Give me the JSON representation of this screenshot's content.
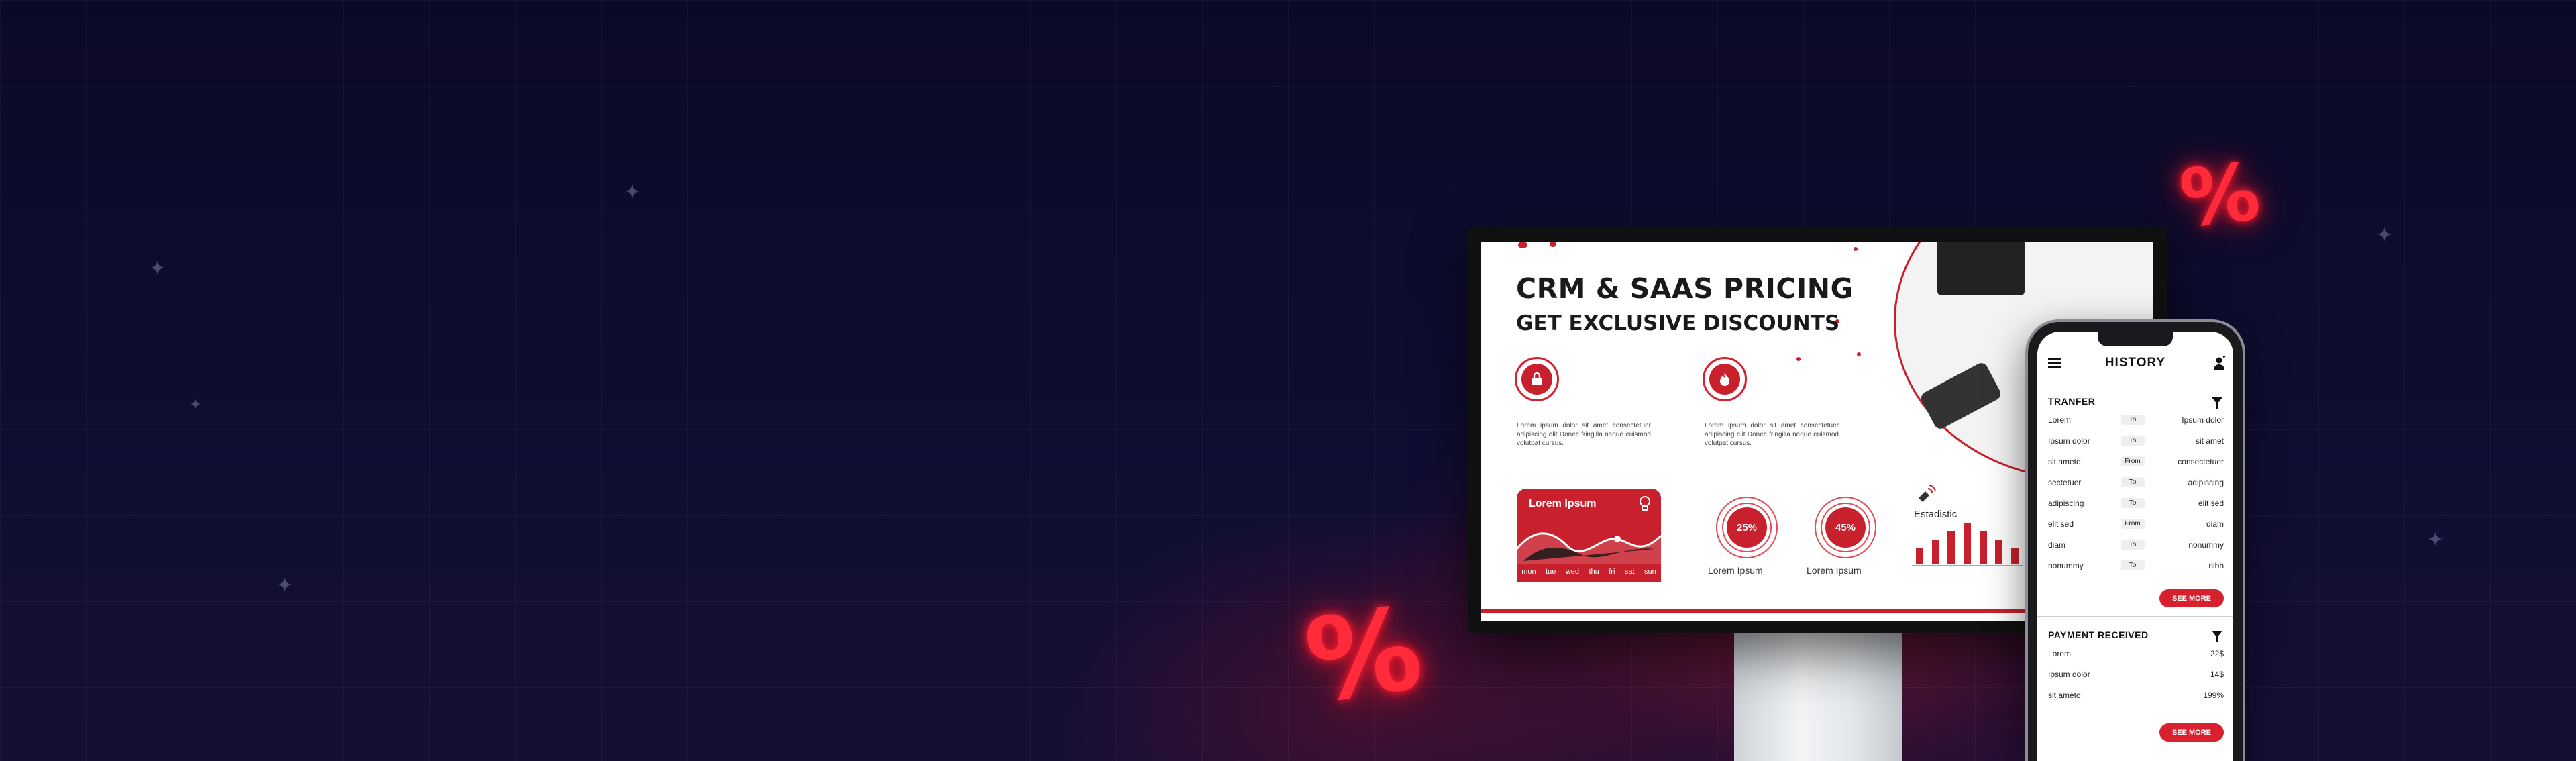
{
  "colors": {
    "accent": "#c8202c",
    "background": "#0c0b2a",
    "neon": "#ff2a3a"
  },
  "decor": {
    "percent_symbol": "%"
  },
  "monitor": {
    "title": "CRM & SAAS PRICING",
    "subtitle": "GET EXCLUSIVE DISCOUNTS",
    "feature_icons": [
      "lock-icon",
      "flame-icon"
    ],
    "lorem_block": "Lorem ipsum dolor sit amet consectetuer adipiscing elit Donec fringilla neque euismod volutpat cursus.",
    "wave_card": {
      "title": "Lorem Ipsum",
      "icon": "lightbulb-icon",
      "days": [
        "mon",
        "tue",
        "wed",
        "thu",
        "fri",
        "sat",
        "sun"
      ]
    },
    "percent_rings": [
      {
        "value": "25%",
        "label": "Lorem Ipsum"
      },
      {
        "value": "45%",
        "label": "Lorem Ipsum"
      }
    ],
    "statistic": {
      "label": "Estadistic",
      "icon": "satellite-icon"
    }
  },
  "chart_data": {
    "type": "bar",
    "values": [
      2,
      3,
      4,
      5,
      4,
      3,
      2
    ],
    "categories": [],
    "title": "Estadistic",
    "xlabel": "",
    "ylabel": ""
  },
  "phone": {
    "title": "HISTORY",
    "transfer": {
      "title": "TRANFER",
      "rows": [
        {
          "left": "Lorem",
          "mid": "To",
          "right": "Ipsum dolor"
        },
        {
          "left": "Ipsum dolor",
          "mid": "To",
          "right": "sit amet"
        },
        {
          "left": "sit ameto",
          "mid": "From",
          "right": "consectetuer"
        },
        {
          "left": "sectetuer",
          "mid": "To",
          "right": "adipiscing"
        },
        {
          "left": "adipiscing",
          "mid": "To",
          "right": "elit sed"
        },
        {
          "left": "elit sed",
          "mid": "From",
          "right": "diam"
        },
        {
          "left": "diam",
          "mid": "To",
          "right": "nonummy"
        },
        {
          "left": "nonummy",
          "mid": "To",
          "right": "nibh"
        }
      ],
      "see_more": "SEE MORE"
    },
    "payment": {
      "title": "PAYMENT RECEIVED",
      "rows": [
        {
          "left": "Lorem",
          "right": "22$"
        },
        {
          "left": "Ipsum dolor",
          "right": "14$"
        },
        {
          "left": "sit ameto",
          "right": "199%"
        }
      ],
      "see_more": "SEE MORE"
    }
  }
}
